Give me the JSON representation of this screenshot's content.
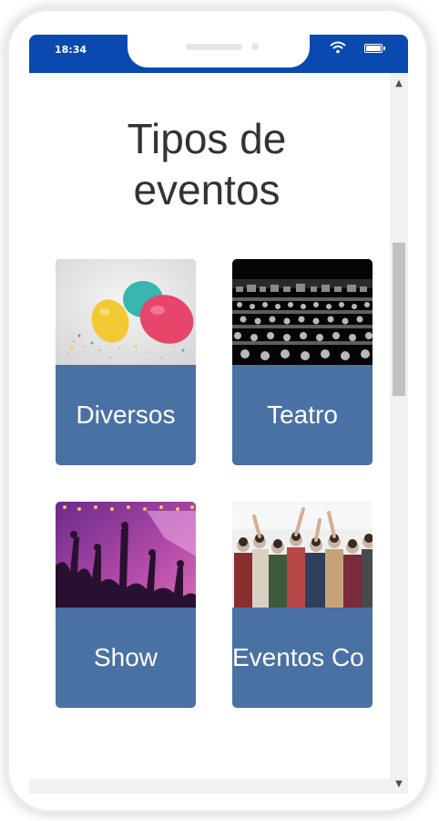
{
  "status_bar": {
    "time": "18:34",
    "wifi_icon": "wifi-icon",
    "battery_icon": "battery-icon",
    "color": "#0a4ab0"
  },
  "page": {
    "title": "Tipos de eventos"
  },
  "cards": [
    {
      "label": "Diversos",
      "image": "balloons-confetti-image"
    },
    {
      "label": "Teatro",
      "image": "theatre-audience-image"
    },
    {
      "label": "Show",
      "image": "concert-crowd-image"
    },
    {
      "label": "Eventos Co",
      "image": "party-crowd-image"
    }
  ],
  "colors": {
    "card_background": "#4a71a4",
    "title_text": "#333333"
  },
  "scrollbar": {
    "up_icon": "scroll-up-arrow-icon",
    "down_icon": "scroll-down-arrow-icon"
  }
}
